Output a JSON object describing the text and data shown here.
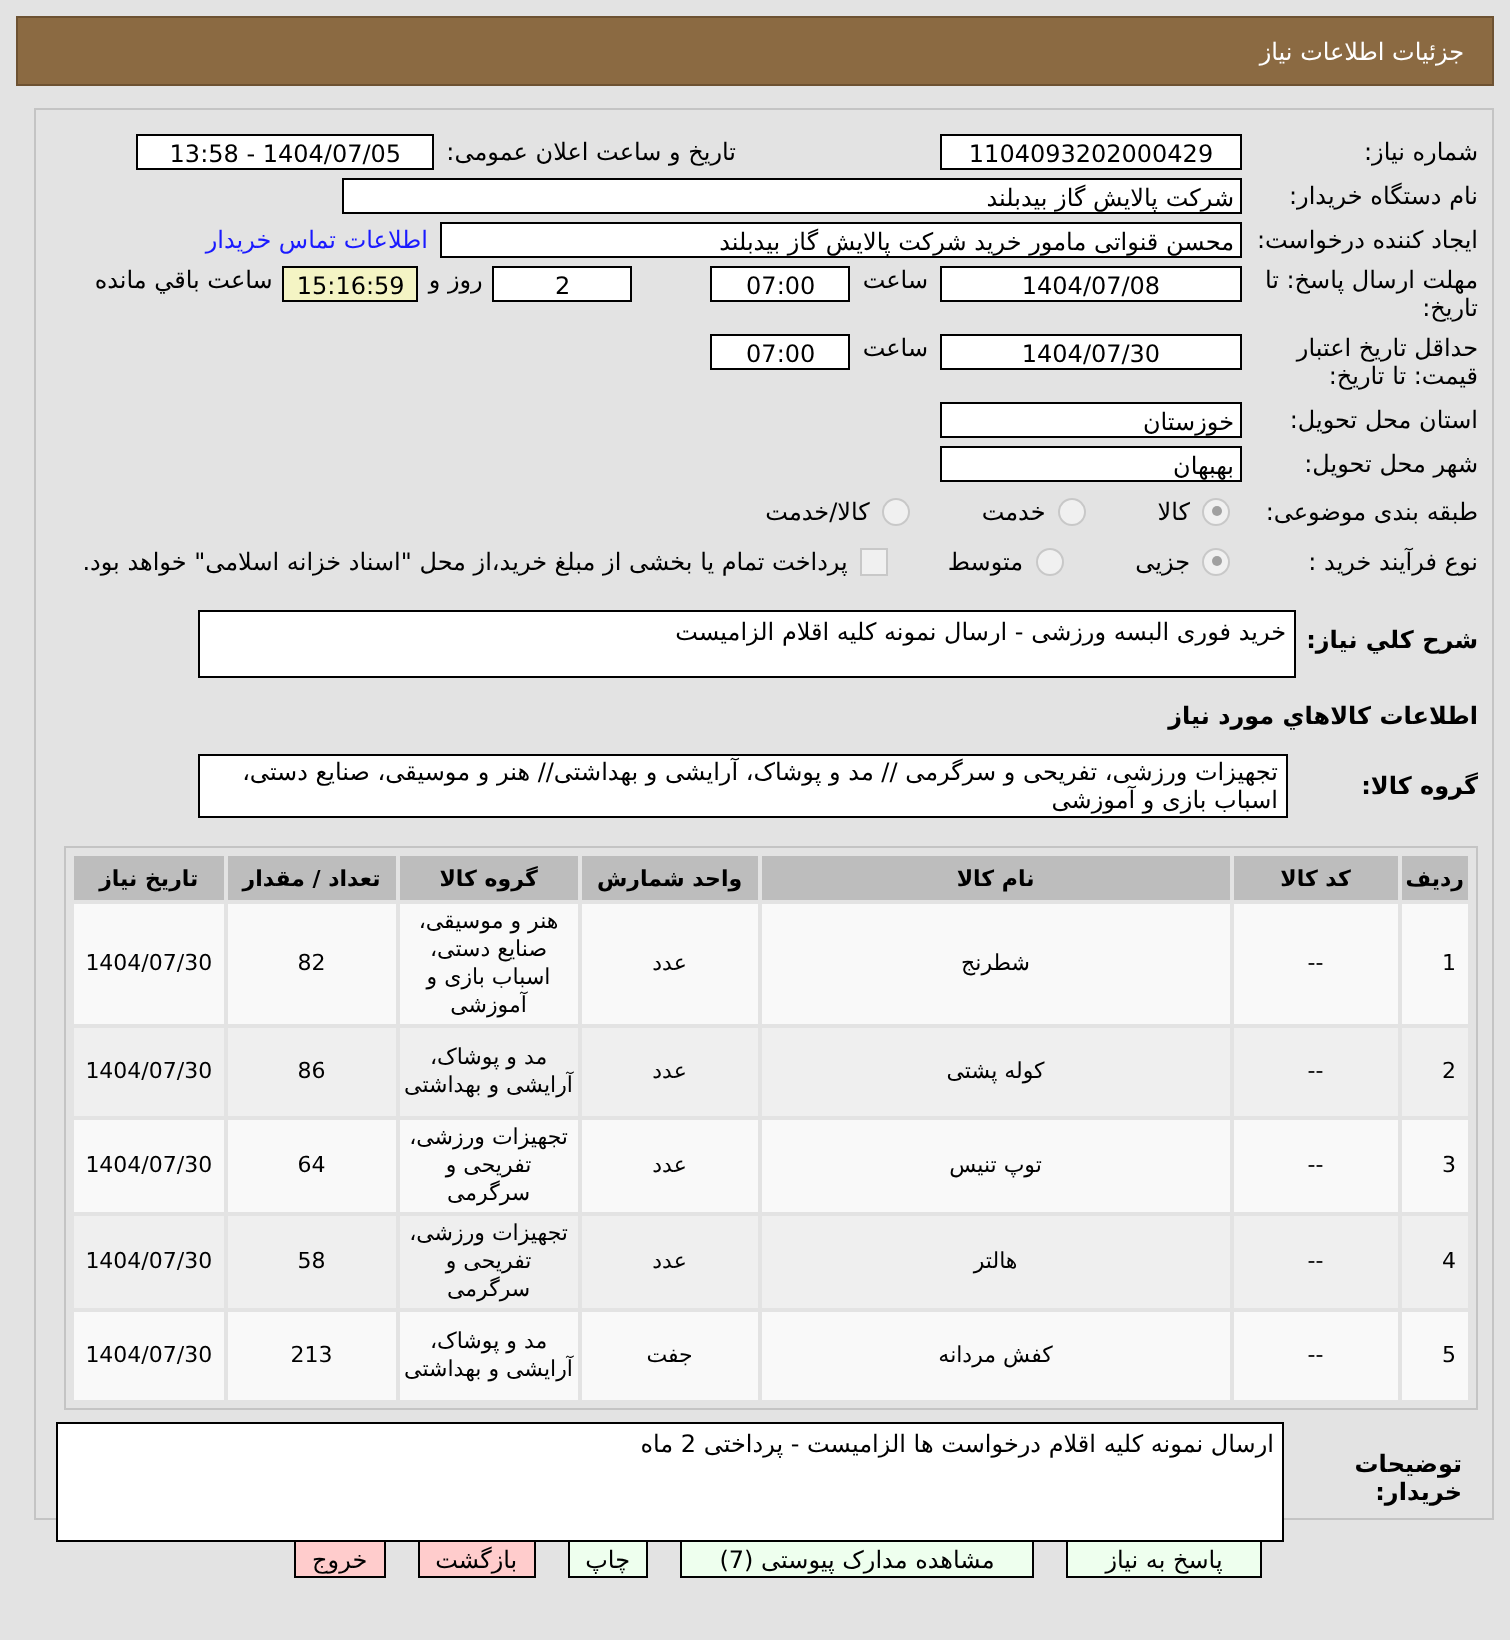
{
  "header": {
    "title": "جزئیات اطلاعات نیاز"
  },
  "need_number": {
    "label": "شماره نیاز:",
    "value": "1104093202000429"
  },
  "announce": {
    "label": "تاریخ و ساعت اعلان عمومی:",
    "value": "1404/07/05 - 13:58"
  },
  "buyer_org": {
    "label": "نام دستگاه خریدار:",
    "value": "شرکت پالایش گاز بیدبلند"
  },
  "requester": {
    "label": "ایجاد کننده درخواست:",
    "value": "محسن قنواتی مامور خرید شرکت پالایش گاز بیدبلند",
    "link": "اطلاعات تماس خریدار"
  },
  "reply_deadline": {
    "label": "مهلت ارسال پاسخ: تا تاریخ:",
    "date": "1404/07/08",
    "time_label": "ساعت",
    "time": "07:00",
    "days": "2",
    "days_label": "روز و",
    "remaining": "15:16:59",
    "remaining_label": "ساعت باقي مانده"
  },
  "price_validity": {
    "label": "حداقل تاریخ اعتبار قیمت: تا تاریخ:",
    "date": "1404/07/30",
    "time_label": "ساعت",
    "time": "07:00"
  },
  "province": {
    "label": "استان محل تحویل:",
    "value": "خوزستان"
  },
  "city": {
    "label": "شهر محل تحویل:",
    "value": "بهبهان"
  },
  "category": {
    "label": "طبقه بندی موضوعی:",
    "options": [
      {
        "label": "کالا",
        "selected": true
      },
      {
        "label": "خدمت",
        "selected": false
      },
      {
        "label": "کالا/خدمت",
        "selected": false
      }
    ]
  },
  "process": {
    "label": "نوع فرآیند خرید :",
    "options": [
      {
        "label": "جزیی",
        "selected": true
      },
      {
        "label": "متوسط",
        "selected": false
      }
    ],
    "payment": {
      "checked": false,
      "text": "پرداخت تمام یا بخشی از مبلغ خرید،از محل \"اسناد خزانه اسلامی\" خواهد بود."
    }
  },
  "description": {
    "label": "شرح کلي نياز:",
    "value": "خرید فوری البسه ورزشی - ارسال نمونه کلیه اقلام الزامیست"
  },
  "goods_heading": "اطلاعات کالاهاي مورد نياز",
  "goods_group": {
    "label": "گروه کالا:",
    "value": "تجهیزات ورزشی، تفریحی و سرگرمی // مد و پوشاک، آرایشی و بهداشتی// هنر و موسیقی، صنایع دستی، اسباب بازی و آموزشی"
  },
  "table": {
    "columns": [
      "ردیف",
      "کد کالا",
      "نام کالا",
      "واحد شمارش",
      "گروه کالا",
      "تعداد / مقدار",
      "تاریخ نیاز"
    ],
    "rows": [
      [
        "1",
        "--",
        "شطرنج",
        "عدد",
        "هنر و موسیقی، صنایع دستی، اسباب بازی و آموزشی",
        "82",
        "1404/07/30"
      ],
      [
        "2",
        "--",
        "کوله پشتی",
        "عدد",
        "مد و پوشاک، آرایشی و بهداشتی",
        "86",
        "1404/07/30"
      ],
      [
        "3",
        "--",
        "توپ تنیس",
        "عدد",
        "تجهیزات ورزشی، تفریحی و سرگرمی",
        "64",
        "1404/07/30"
      ],
      [
        "4",
        "--",
        "هالتر",
        "عدد",
        "تجهیزات ورزشی، تفریحی و سرگرمی",
        "58",
        "1404/07/30"
      ],
      [
        "5",
        "--",
        "کفش مردانه",
        "جفت",
        "مد و پوشاک، آرایشی و بهداشتی",
        "213",
        "1404/07/30"
      ]
    ]
  },
  "buyer_notes": {
    "label": "توضیحات خریدار:",
    "value": "ارسال نمونه کلیه اقلام درخواست ها الزامیست - پرداختی 2 ماه"
  },
  "buttons": [
    {
      "label": "پاسخ به نیاز",
      "kind": "action"
    },
    {
      "label": "مشاهده مدارک پیوستی (7)",
      "kind": "action"
    },
    {
      "label": "چاپ",
      "kind": "action"
    },
    {
      "label": "بازگشت",
      "kind": "exit"
    },
    {
      "label": "خروج",
      "kind": "exit"
    }
  ]
}
